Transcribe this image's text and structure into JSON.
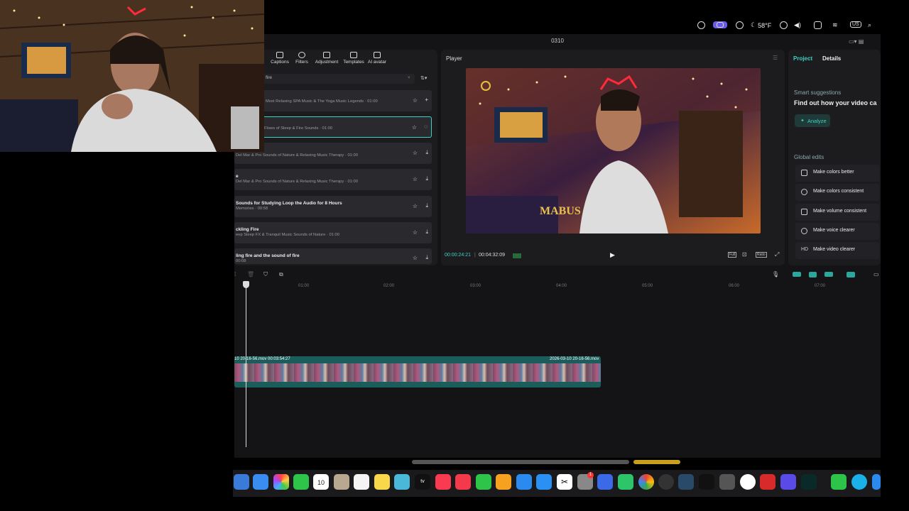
{
  "menubar": {
    "weather": "58°F",
    "input_badge": "US"
  },
  "window": {
    "title": "0310"
  },
  "media_toolbar": {
    "tools": [
      "Captions",
      "Filters",
      "Adjustment",
      "Templates",
      "AI avatar"
    ]
  },
  "search": {
    "value": "fire"
  },
  "media_rows": [
    {
      "title": "",
      "subtitle": "Most Relaxing SPA Music & The Yoga Music Legends · 01:00"
    },
    {
      "title": "",
      "subtitle": "Flows of Sleep & Fire Sounds · 01:00"
    },
    {
      "title": "",
      "subtitle": "Del Mar & Pro Sounds of Nature & Relaxing Music Therapy · 01:00"
    },
    {
      "title": "e",
      "subtitle": "Del Mar & Pro Sounds of Nature & Relaxing Music Therapy · 01:00"
    },
    {
      "title": "Sounds for Studying Loop the Audio for 8 Hours",
      "subtitle": "Memories · 00:58"
    },
    {
      "title": "ckling Fire",
      "subtitle": "eep Sleep FX & Tranquil Music Sounds of Nature · 01:00"
    },
    {
      "title": "ling fire and the sound of fire",
      "subtitle": "00:08"
    }
  ],
  "player": {
    "label": "Player",
    "current_time": "00:00:24:21",
    "total_time": "00:04:32:09",
    "full_label": "Full",
    "ratio_label": "Ratio",
    "overlay_text": "MABUS"
  },
  "right_panel": {
    "tab_project": "Project",
    "tab_details": "Details",
    "smart_title": "Smart suggestions",
    "smart_text": "Find out how your video ca",
    "analyze": "Analyze",
    "global_title": "Global edits",
    "edits": [
      "Make colors better",
      "Make colors consistent",
      "Make volume consistent",
      "Make voice clearer",
      "Make video clearer"
    ]
  },
  "timeline": {
    "ticks": [
      "01:00",
      "02:00",
      "03:00",
      "04:00",
      "05:00",
      "06:00",
      "07:00"
    ],
    "clip_label": "10 20-16-56.mov  00:03:54:27",
    "clip_label2": "2026-03-10 20-16-56.mov"
  },
  "dock": {
    "calendar_day": "10",
    "notification_count": "1"
  },
  "colors": {
    "accent": "#3fd1c4",
    "panel": "#1c1c1f",
    "clip": "#1a5d5a"
  }
}
